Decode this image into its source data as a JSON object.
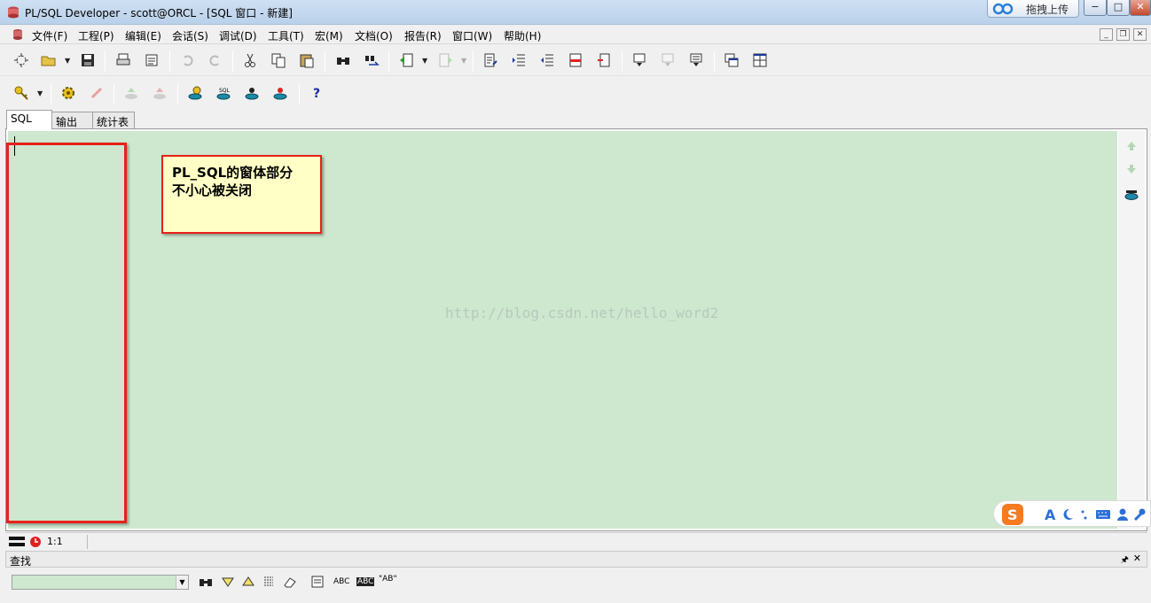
{
  "window": {
    "title": "PL/SQL Developer - scott@ORCL - [SQL 窗口 - 新建]",
    "upload_label": "拖拽上传",
    "controls": {
      "minimize": "−",
      "maximize": "□",
      "close": "✕"
    }
  },
  "menu": {
    "items": [
      "文件(F)",
      "工程(P)",
      "编辑(E)",
      "会话(S)",
      "调试(D)",
      "工具(T)",
      "宏(M)",
      "文档(O)",
      "报告(R)",
      "窗口(W)",
      "帮助(H)"
    ]
  },
  "tabs": {
    "sql": "SQL",
    "output": "输出",
    "stats": "统计表"
  },
  "editor": {
    "watermark": "http://blog.csdn.net/hello_word2",
    "background": "#cde8cf"
  },
  "annotation": {
    "line1": "PL_SQL的窗体部分",
    "line2": "不小心被关闭",
    "border_color": "#e8211a",
    "note_bg": "#ffffc6"
  },
  "status": {
    "position": "1:1"
  },
  "find": {
    "title": "查找",
    "value": "",
    "buttons": {
      "match_case": "ABC",
      "whole_word": "ABC",
      "quoted": "\"AB\""
    }
  },
  "icons": [
    "app-icon",
    "new-icon",
    "open-icon",
    "save-icon",
    "print-icon",
    "undo-icon",
    "redo-icon",
    "cut-icon",
    "copy-icon",
    "paste-icon",
    "find-icon",
    "replace-icon",
    "execute-icon",
    "help-icon"
  ]
}
